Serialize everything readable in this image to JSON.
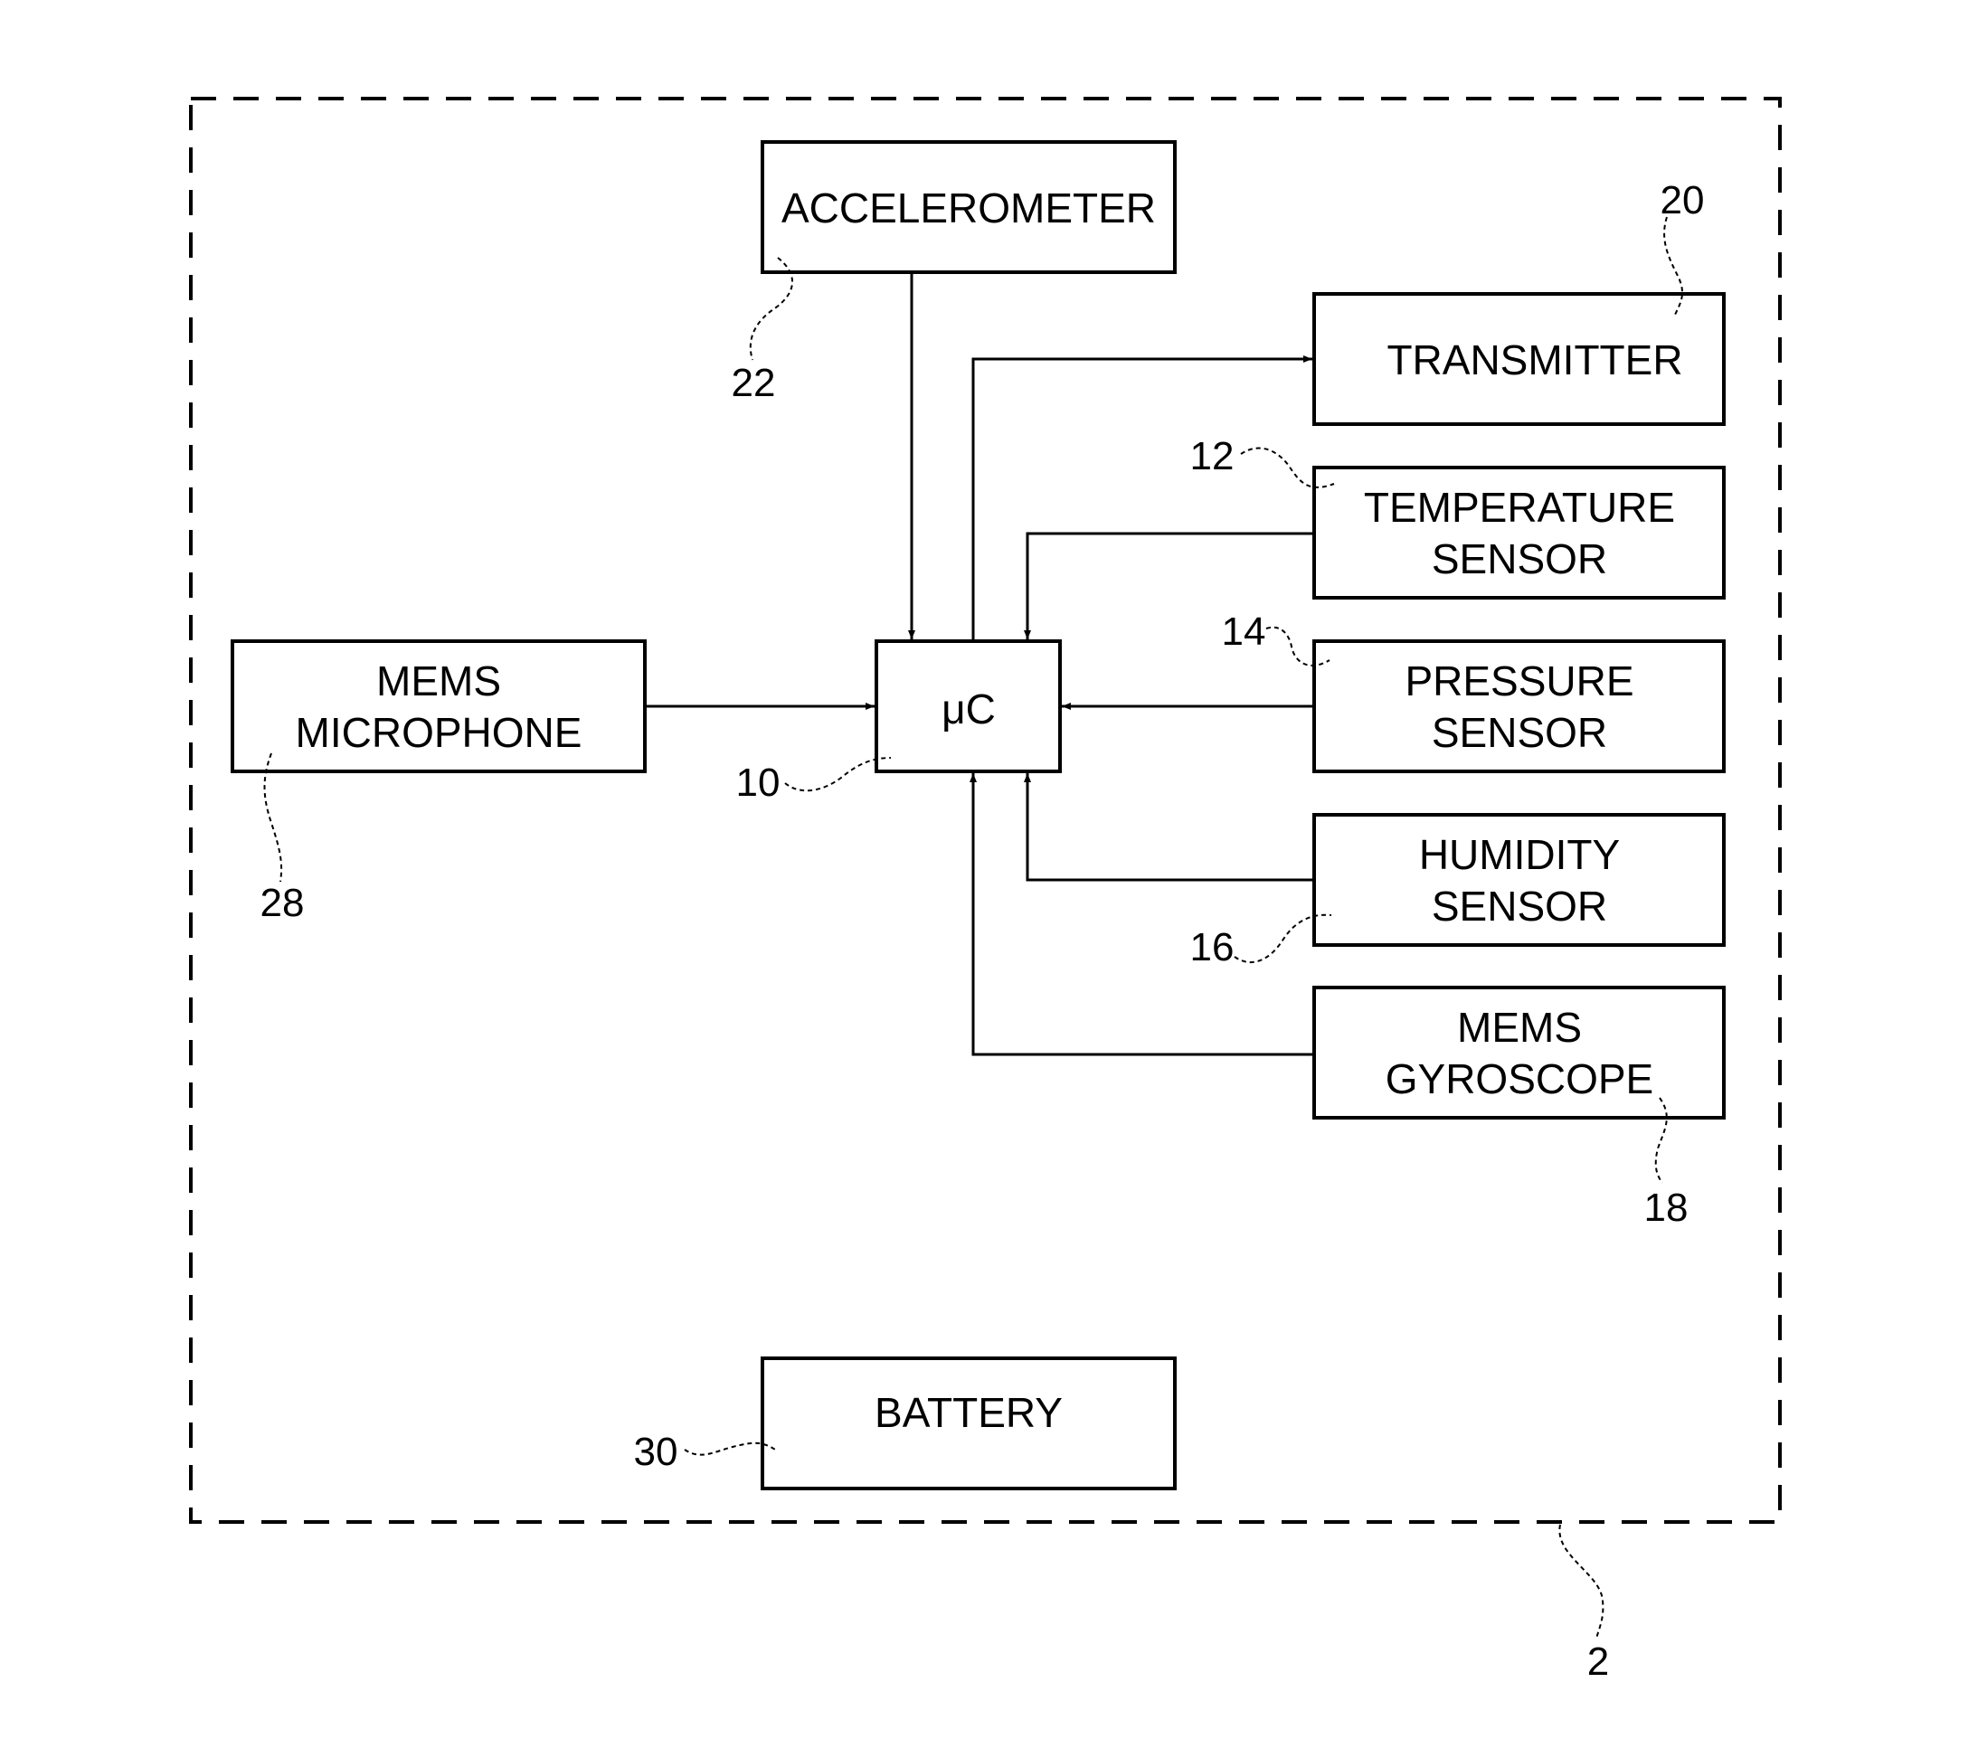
{
  "figure": {
    "enclosure": {
      "ref": "2"
    },
    "blocks": {
      "accelerometer": {
        "lines": [
          "ACCELEROMETER"
        ],
        "ref": "22"
      },
      "transmitter": {
        "lines": [
          "TRANSMITTER"
        ],
        "ref": "20"
      },
      "temperature_sensor": {
        "lines": [
          "TEMPERATURE",
          "SENSOR"
        ],
        "ref": "12"
      },
      "pressure_sensor": {
        "lines": [
          "PRESSURE",
          "SENSOR"
        ],
        "ref": "14"
      },
      "humidity_sensor": {
        "lines": [
          "HUMIDITY",
          "SENSOR"
        ],
        "ref": "16"
      },
      "mems_gyroscope": {
        "lines": [
          "MEMS",
          "GYROSCOPE"
        ],
        "ref": "18"
      },
      "mems_microphone": {
        "lines": [
          "MEMS",
          "MICROPHONE"
        ],
        "ref": "28"
      },
      "microcontroller": {
        "lines": [
          "μC"
        ],
        "ref": "10"
      },
      "battery": {
        "lines": [
          "BATTERY"
        ],
        "ref": "30"
      }
    },
    "connections": [
      {
        "from": "accelerometer",
        "to": "microcontroller"
      },
      {
        "from": "microcontroller",
        "to": "transmitter"
      },
      {
        "from": "temperature_sensor",
        "to": "microcontroller"
      },
      {
        "from": "pressure_sensor",
        "to": "microcontroller"
      },
      {
        "from": "humidity_sensor",
        "to": "microcontroller"
      },
      {
        "from": "mems_gyroscope",
        "to": "microcontroller"
      },
      {
        "from": "mems_microphone",
        "to": "microcontroller"
      }
    ]
  }
}
